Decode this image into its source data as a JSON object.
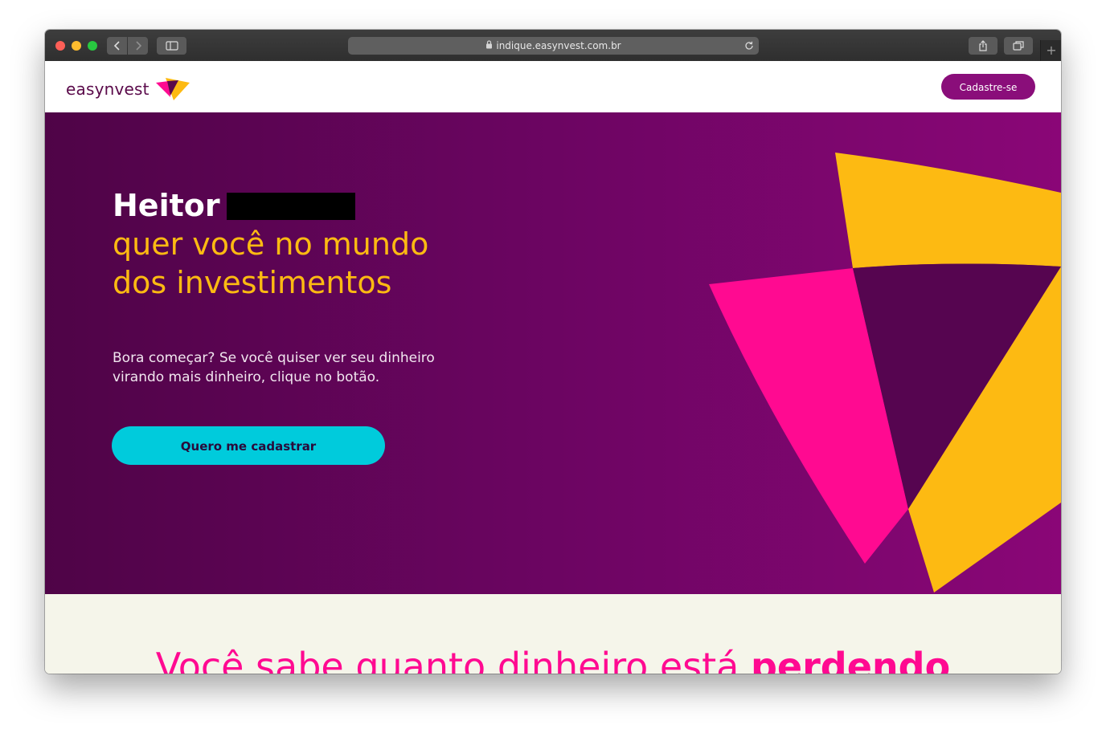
{
  "browser": {
    "url": "indique.easynvest.com.br",
    "back_icon": "chevron-left-icon",
    "forward_icon": "chevron-right-icon",
    "sidebar_icon": "sidebar-icon",
    "share_icon": "share-icon",
    "tabs_icon": "tabs-overview-icon",
    "newtab_icon": "plus-icon",
    "reload_icon": "reload-icon"
  },
  "header": {
    "logo_text": "easynvest",
    "signup_label": "Cadastre-se"
  },
  "hero": {
    "name": "Heitor",
    "title": "quer você no mundo dos investimentos",
    "subtitle": "Bora começar? Se você quiser ver seu dinheiro virando mais dinheiro, clique no botão.",
    "cta_label": "Quero me cadastrar"
  },
  "section2": {
    "title_part1": "Você sabe quanto dinheiro está",
    "title_bold": "perdendo"
  },
  "colors": {
    "brand_purple": "#8a0e7a",
    "hero_dark": "#4f0447",
    "accent_yellow": "#fdba12",
    "accent_pink": "#ff0a91",
    "accent_cyan": "#00cbdc",
    "section_bg": "#f5f5ea"
  }
}
